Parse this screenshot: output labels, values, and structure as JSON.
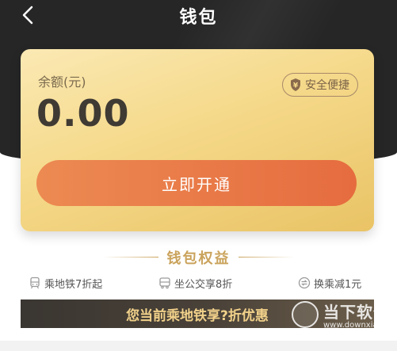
{
  "header": {
    "title": "钱包",
    "back_icon": "chevron-left-icon"
  },
  "card": {
    "balance_label": "余额(元)",
    "balance_value": "0.00",
    "secure_badge_label": "安全便捷",
    "secure_badge_icon": "shield-yen-icon",
    "open_button_label": "立即开通"
  },
  "benefits": {
    "title": "钱包权益",
    "items": [
      {
        "label": "乘地铁7折起",
        "icon": "subway-icon"
      },
      {
        "label": "坐公交享8折",
        "icon": "bus-icon"
      },
      {
        "label": "换乘减1元",
        "icon": "transfer-icon"
      }
    ]
  },
  "promo": {
    "text": "您当前乘地铁享?折优惠"
  },
  "watermark": {
    "text": "当下软件园",
    "url": "www.downxia.com"
  },
  "colors": {
    "header_bg": "#262626",
    "card_gold": "#f5d98a",
    "button_orange": "#e66c3f",
    "accent_gold": "#caa35c"
  }
}
